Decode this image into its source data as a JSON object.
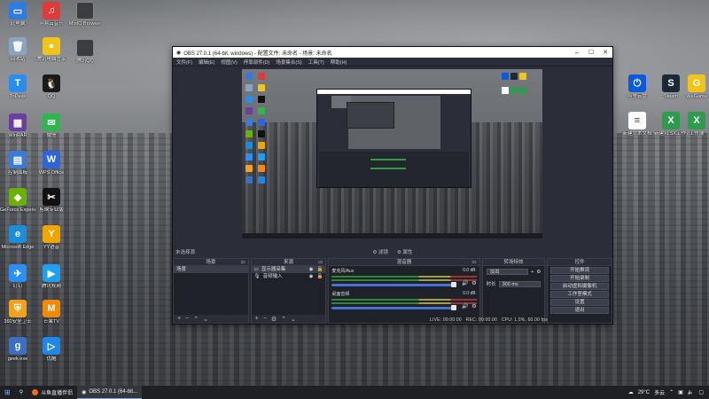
{
  "desktop": {
    "left_icons": [
      {
        "label": "此电脑",
        "color": "#2f7be0",
        "glyph": "▭"
      },
      {
        "label": "网易云音乐",
        "color": "#e03b3b",
        "glyph": "♫"
      },
      {
        "label": "回收站",
        "color": "#8aa3c2",
        "glyph": "🗑"
      },
      {
        "label": "腾讯电脑管家",
        "color": "#f0c419",
        "glyph": "●"
      },
      {
        "label": "ToDesk",
        "color": "#2b8cf0",
        "glyph": "T"
      },
      {
        "label": "QQ",
        "color": "#1a1a1a",
        "glyph": "🐧"
      },
      {
        "label": "WinRAR",
        "color": "#6a3fa0",
        "glyph": "▦"
      },
      {
        "label": "微信",
        "color": "#2db84d",
        "glyph": "✉"
      },
      {
        "label": "控制面板",
        "color": "#3b7bd6",
        "glyph": "▤"
      },
      {
        "label": "WPS Office",
        "color": "#2d66d9",
        "glyph": "W"
      },
      {
        "label": "GeForce Experience",
        "color": "#6ab100",
        "glyph": "◆"
      },
      {
        "label": "剪映专业版",
        "color": "#111111",
        "glyph": "✂"
      },
      {
        "label": "Microsoft Edge",
        "color": "#1b8ed9",
        "glyph": "e"
      },
      {
        "label": "YY语音",
        "color": "#f0a500",
        "glyph": "Y"
      },
      {
        "label": "钉钉",
        "color": "#2a8ff7",
        "glyph": "✈"
      },
      {
        "label": "腾讯视频",
        "color": "#1ea0f0",
        "glyph": "▶"
      },
      {
        "label": "360安全卫士",
        "color": "#f2a21a",
        "glyph": "⛨"
      },
      {
        "label": "芒果TV",
        "color": "#f08a00",
        "glyph": "M"
      },
      {
        "label": "geek.exe",
        "color": "#3a6fc4",
        "glyph": "g"
      },
      {
        "label": "优酷",
        "color": "#1f87e8",
        "glyph": "▷"
      }
    ],
    "top_icons": [
      {
        "label": "MinIO Browser",
        "color": "#333"
      },
      {
        "label": "腾讯QQ",
        "color": "#333"
      }
    ],
    "right_icons": [
      {
        "label": "阿里云盘",
        "color": "#0b5ad9",
        "glyph": "⏻"
      },
      {
        "label": "Steam",
        "color": "#1b2838",
        "glyph": "S"
      },
      {
        "label": "WeGame",
        "color": "#f0c419",
        "glyph": "G"
      },
      {
        "label": "新建文本文档",
        "color": "#ffffff",
        "glyph": "≡"
      },
      {
        "label": "新建XLSX工作表",
        "color": "#2e9b4f",
        "glyph": "X"
      },
      {
        "label": "工作簿",
        "color": "#2e9b4f",
        "glyph": "X"
      }
    ]
  },
  "obs": {
    "title": "OBS 27.0.1 (64-bit, windows) - 配置文件: 未命名 - 场景: 未命名",
    "menu": [
      "文件(F)",
      "编辑(E)",
      "视图(V)",
      "停靠部件(D)",
      "场景集合(S)",
      "工具(T)",
      "帮助(H)"
    ],
    "preview_toolbar": {
      "filters": "滤镜",
      "properties": "属性"
    },
    "not_selected": "未选择源",
    "docks": {
      "scenes": {
        "title": "场景",
        "items": [
          "场景"
        ]
      },
      "sources": {
        "title": "来源",
        "items": [
          "显示器采集",
          "音频输入"
        ]
      },
      "mixer": {
        "title": "混音器",
        "tracks": [
          {
            "name": "麦克风/Aux",
            "db": "0.0 dB"
          },
          {
            "name": "桌面音频",
            "db": "0.0 dB"
          }
        ]
      },
      "transitions": {
        "title": "转场特效",
        "type": "淡出",
        "duration_label": "时长",
        "duration": "300 ms"
      },
      "controls": {
        "title": "控件",
        "buttons": [
          "开始推流",
          "开始录制",
          "启动虚拟摄像机",
          "工作室模式",
          "设置",
          "退出"
        ]
      }
    },
    "status": {
      "live": "LIVE: 00:00:00",
      "rec": "REC: 00:00:00",
      "cpu": "CPU: 1.0%, 60.00 fps"
    }
  },
  "taskbar": {
    "start": "⊞",
    "search_icon": "⚲",
    "items": [
      {
        "label": "斗鱼直播伴侣",
        "active": false
      },
      {
        "label": "OBS 27.0.1 (64-bit...",
        "active": true
      }
    ],
    "weather": "29°C",
    "weather_text": "多云"
  }
}
